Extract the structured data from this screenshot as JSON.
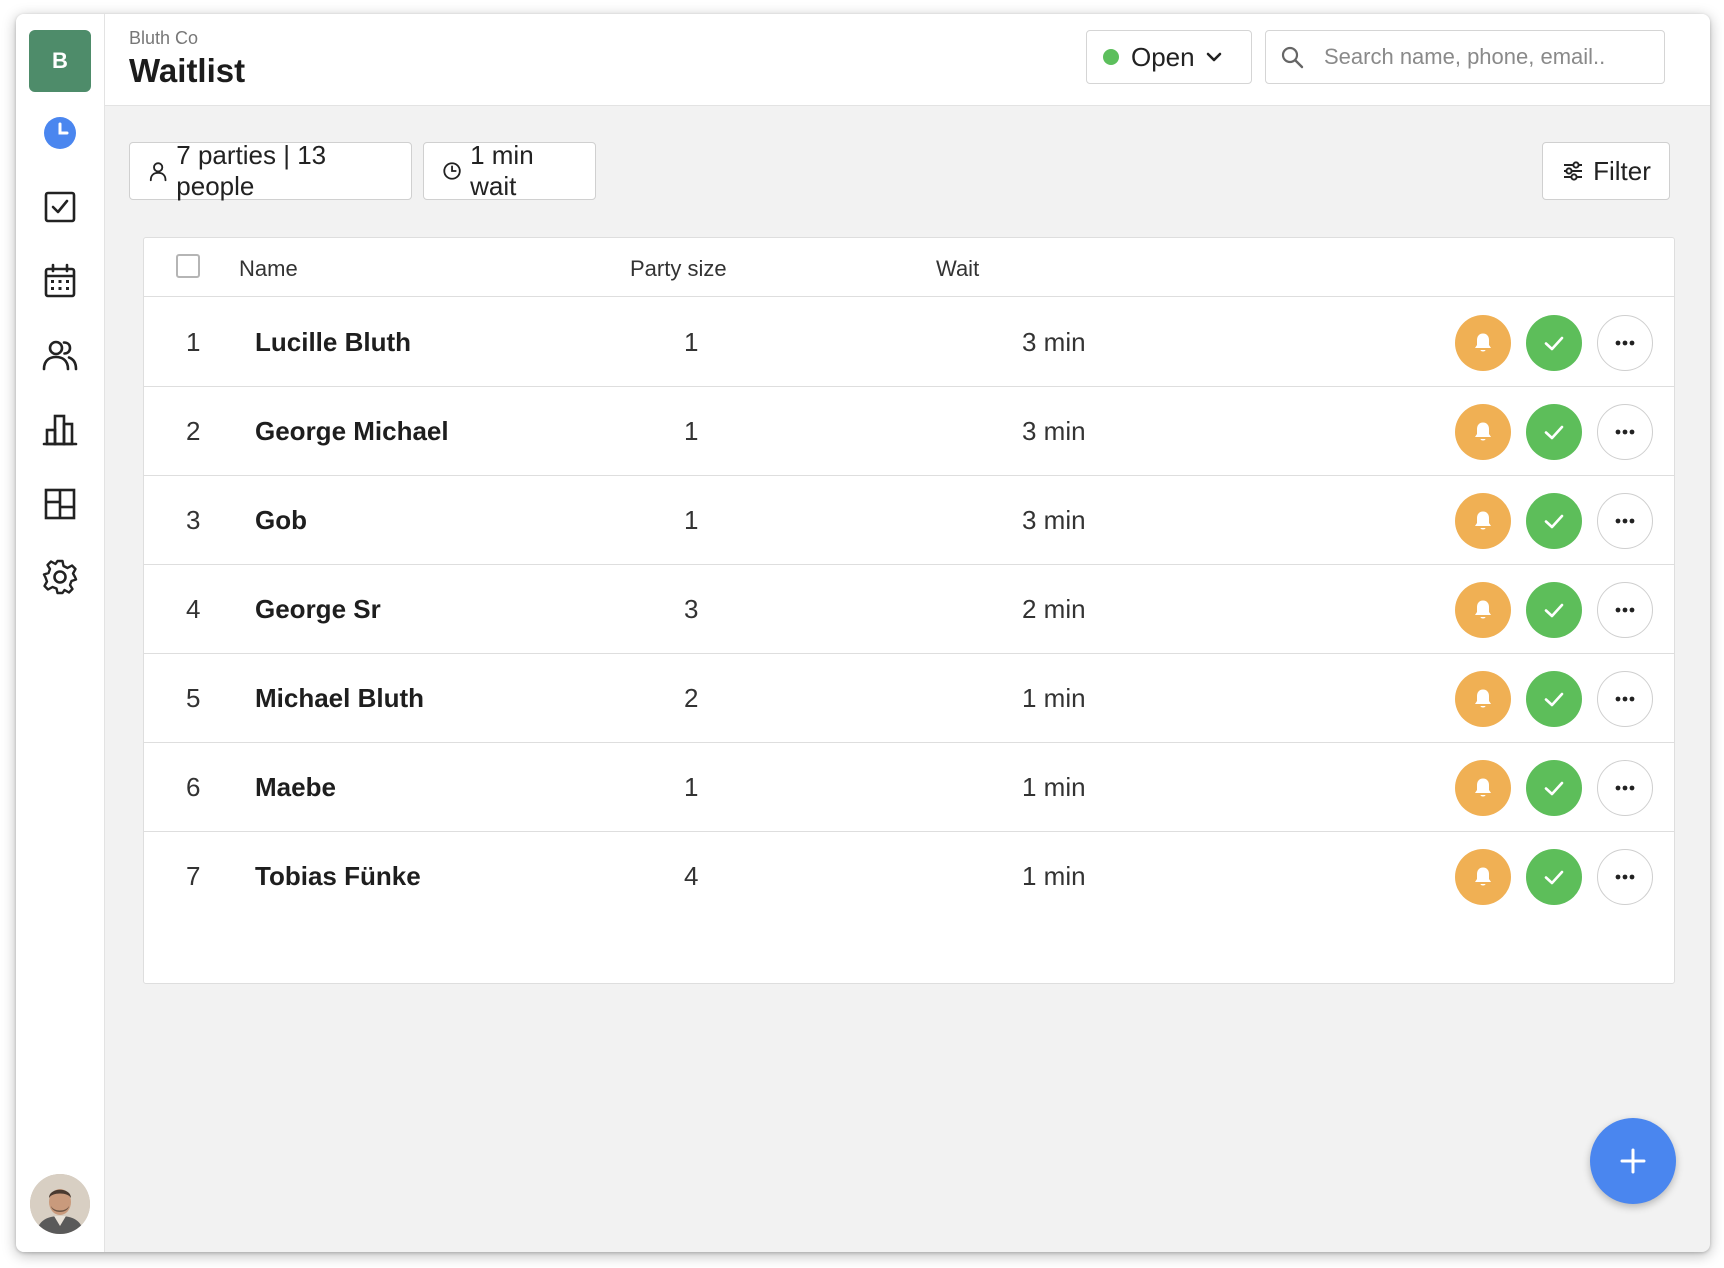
{
  "sidebar": {
    "brand_initial": "B",
    "items": [
      {
        "name": "waitlist",
        "icon": "clock-icon",
        "active": true
      },
      {
        "name": "tasks",
        "icon": "checkbox-icon"
      },
      {
        "name": "calendar",
        "icon": "calendar-icon"
      },
      {
        "name": "guests",
        "icon": "users-icon"
      },
      {
        "name": "analytics",
        "icon": "bar-chart-icon"
      },
      {
        "name": "floor-plan",
        "icon": "layout-icon"
      },
      {
        "name": "settings",
        "icon": "gear-icon"
      }
    ]
  },
  "header": {
    "company": "Bluth Co",
    "title": "Waitlist",
    "status": "Open",
    "search_placeholder": "Search name, phone, email.."
  },
  "toolbar": {
    "parties": "7 parties | 13 people",
    "wait": "1 min wait",
    "filter": "Filter"
  },
  "table": {
    "columns": [
      "Name",
      "Party size",
      "Wait"
    ],
    "rows": [
      {
        "num": "1",
        "name": "Lucille Bluth",
        "size": "1",
        "wait": "3 min"
      },
      {
        "num": "2",
        "name": "George Michael",
        "size": "1",
        "wait": "3 min"
      },
      {
        "num": "3",
        "name": "Gob",
        "size": "1",
        "wait": "3 min"
      },
      {
        "num": "4",
        "name": "George Sr",
        "size": "3",
        "wait": "2 min"
      },
      {
        "num": "5",
        "name": "Michael Bluth",
        "size": "2",
        "wait": "1 min"
      },
      {
        "num": "6",
        "name": "Maebe",
        "size": "1",
        "wait": "1 min"
      },
      {
        "num": "7",
        "name": "Tobias Fünke",
        "size": "4",
        "wait": "1 min"
      }
    ]
  },
  "colors": {
    "brand": "#4e8c6a",
    "accent": "#4a86ef",
    "notify": "#f0b054",
    "seat": "#5dbe5a",
    "status_open": "#5cbf5c"
  }
}
